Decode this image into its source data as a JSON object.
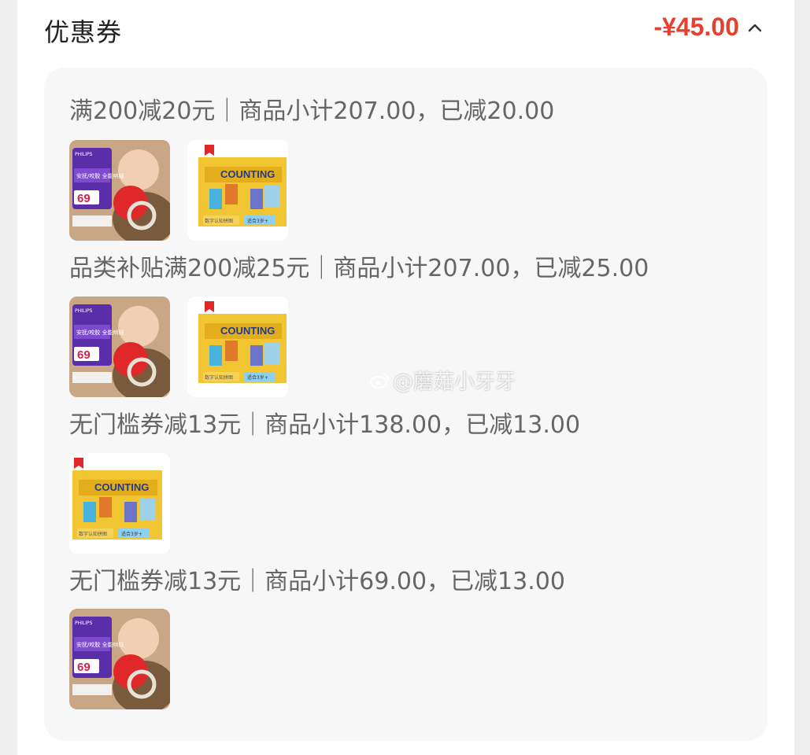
{
  "header": {
    "title": "优惠券",
    "discount_total": "-¥45.00",
    "toggle_icon": "chevron-up-icon"
  },
  "coupon_groups": [
    {
      "label": "满200减20元｜商品小计207.00，已减20.00",
      "products": [
        "teether-rattle",
        "counting-puzzle"
      ]
    },
    {
      "label": "品类补贴满200减25元｜商品小计207.00，已减25.00",
      "products": [
        "teether-rattle",
        "counting-puzzle"
      ]
    },
    {
      "label": "无门槛券减13元｜商品小计138.00，已减13.00",
      "products": [
        "counting-puzzle"
      ]
    },
    {
      "label": "无门槛券减13元｜商品小计69.00，已减13.00",
      "products": [
        "teether-rattle"
      ]
    }
  ],
  "products": {
    "teether_rattle": {
      "brand": "PHILIPS",
      "headline": "安抚/咬胶 全能哄娃",
      "price": "69"
    },
    "counting_puzzle": {
      "box_title": "COUNTING",
      "footer_left": "数字认知拼图",
      "footer_right": "适合3岁+"
    }
  },
  "watermark": "@蘑菇小牙牙",
  "colors": {
    "accent_red": "#e8402e",
    "panel_bg": "#f7f7f7",
    "text_muted": "#666666"
  }
}
